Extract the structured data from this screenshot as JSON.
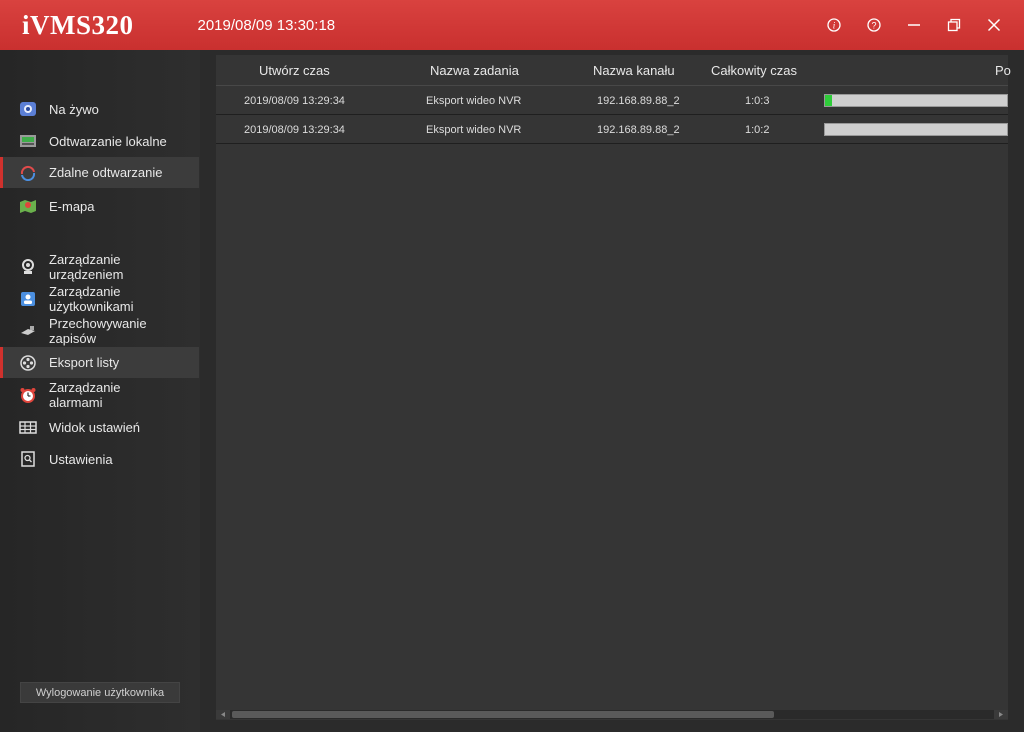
{
  "app": {
    "title": "iVMS320",
    "datetime": "2019/08/09 13:30:18"
  },
  "window_controls": [
    {
      "name": "info-icon"
    },
    {
      "name": "help-icon"
    },
    {
      "name": "minimize-icon"
    },
    {
      "name": "restore-icon"
    },
    {
      "name": "close-icon"
    }
  ],
  "sidebar": {
    "items": [
      {
        "label": "Na żywo",
        "icon": "live-view-icon"
      },
      {
        "label": "Odtwarzanie lokalne",
        "icon": "local-playback-icon"
      },
      {
        "label": "Zdalne odtwarzanie",
        "icon": "remote-playback-icon",
        "active": true
      },
      {
        "label": "E-mapa",
        "icon": "emap-icon"
      },
      {
        "label": "Zarządzanie\nurządzeniem",
        "icon": "device-management-icon"
      },
      {
        "label": "Zarządzanie\nużytkownikami",
        "icon": "user-management-icon"
      },
      {
        "label": "Przechowywanie\nzapisów",
        "icon": "storage-icon"
      },
      {
        "label": "Eksport listy",
        "icon": "export-list-icon",
        "active": true
      },
      {
        "label": "Zarządzanie\nalarmami",
        "icon": "alarm-icon"
      },
      {
        "label": "Widok ustawień",
        "icon": "view-settings-icon"
      },
      {
        "label": "Ustawienia",
        "icon": "settings-icon"
      }
    ],
    "logout_label": "Wylogowanie użytkownika"
  },
  "table": {
    "columns": [
      "Utwórz czas",
      "Nazwa zadania",
      "Nazwa kanału",
      "Całkowity czas",
      "Po"
    ],
    "rows": [
      {
        "create_time": "2019/08/09 13:29:34",
        "task_name": "Eksport wideo NVR",
        "channel": "192.168.89.88_2",
        "total_time": "1:0:3",
        "progress": 0.04
      },
      {
        "create_time": "2019/08/09 13:29:34",
        "task_name": "Eksport wideo NVR",
        "channel": "192.168.89.88_2",
        "total_time": "1:0:2",
        "progress": 0
      }
    ]
  },
  "colors": {
    "titlebar": "#d13a38",
    "accent": "#d0312d",
    "progress_fill": "#2fcc3a"
  }
}
